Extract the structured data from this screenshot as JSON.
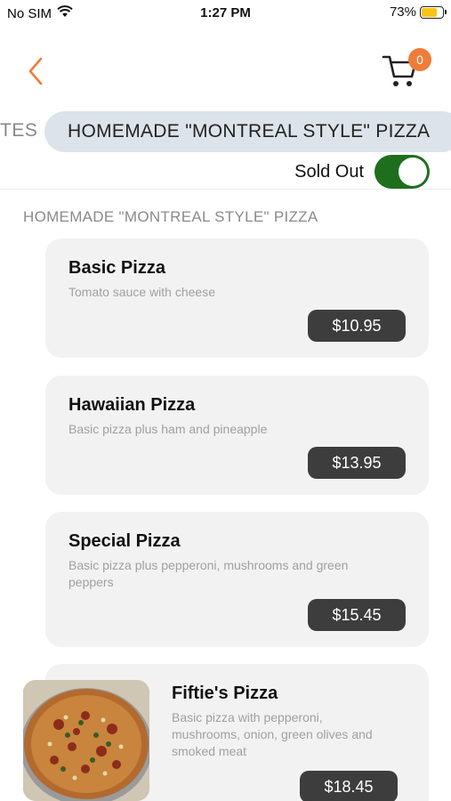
{
  "status_bar": {
    "carrier": "No SIM",
    "time": "1:27 PM",
    "battery_percent": "73%",
    "battery_level": 0.73
  },
  "nav": {
    "back_icon": "chevron-left-icon",
    "cart_icon": "cart-icon",
    "cart_count": "0",
    "accent_color": "#f07c3a"
  },
  "category_tabs": {
    "previous_tab_partial": "TES",
    "active_tab": "HOMEMADE \"MONTREAL STYLE\" PIZZA"
  },
  "sold_out": {
    "label": "Sold Out",
    "enabled": true,
    "toggle_color": "#1e6e1e"
  },
  "section": {
    "header": "HOMEMADE \"MONTREAL STYLE\" PIZZA"
  },
  "menu_items": [
    {
      "name": "Basic Pizza",
      "description": "Tomato sauce with cheese",
      "price": "$10.95"
    },
    {
      "name": "Hawaiian Pizza",
      "description": "Basic pizza plus ham and pineapple",
      "price": "$13.95"
    },
    {
      "name": "Special Pizza",
      "description": "Basic pizza plus pepperoni, mushrooms and green peppers",
      "price": "$15.45"
    },
    {
      "name": "Fiftie's Pizza",
      "description": "Basic pizza with pepperoni, mushrooms, onion, green olives and smoked meat",
      "price": "$18.45",
      "has_image": true
    }
  ]
}
